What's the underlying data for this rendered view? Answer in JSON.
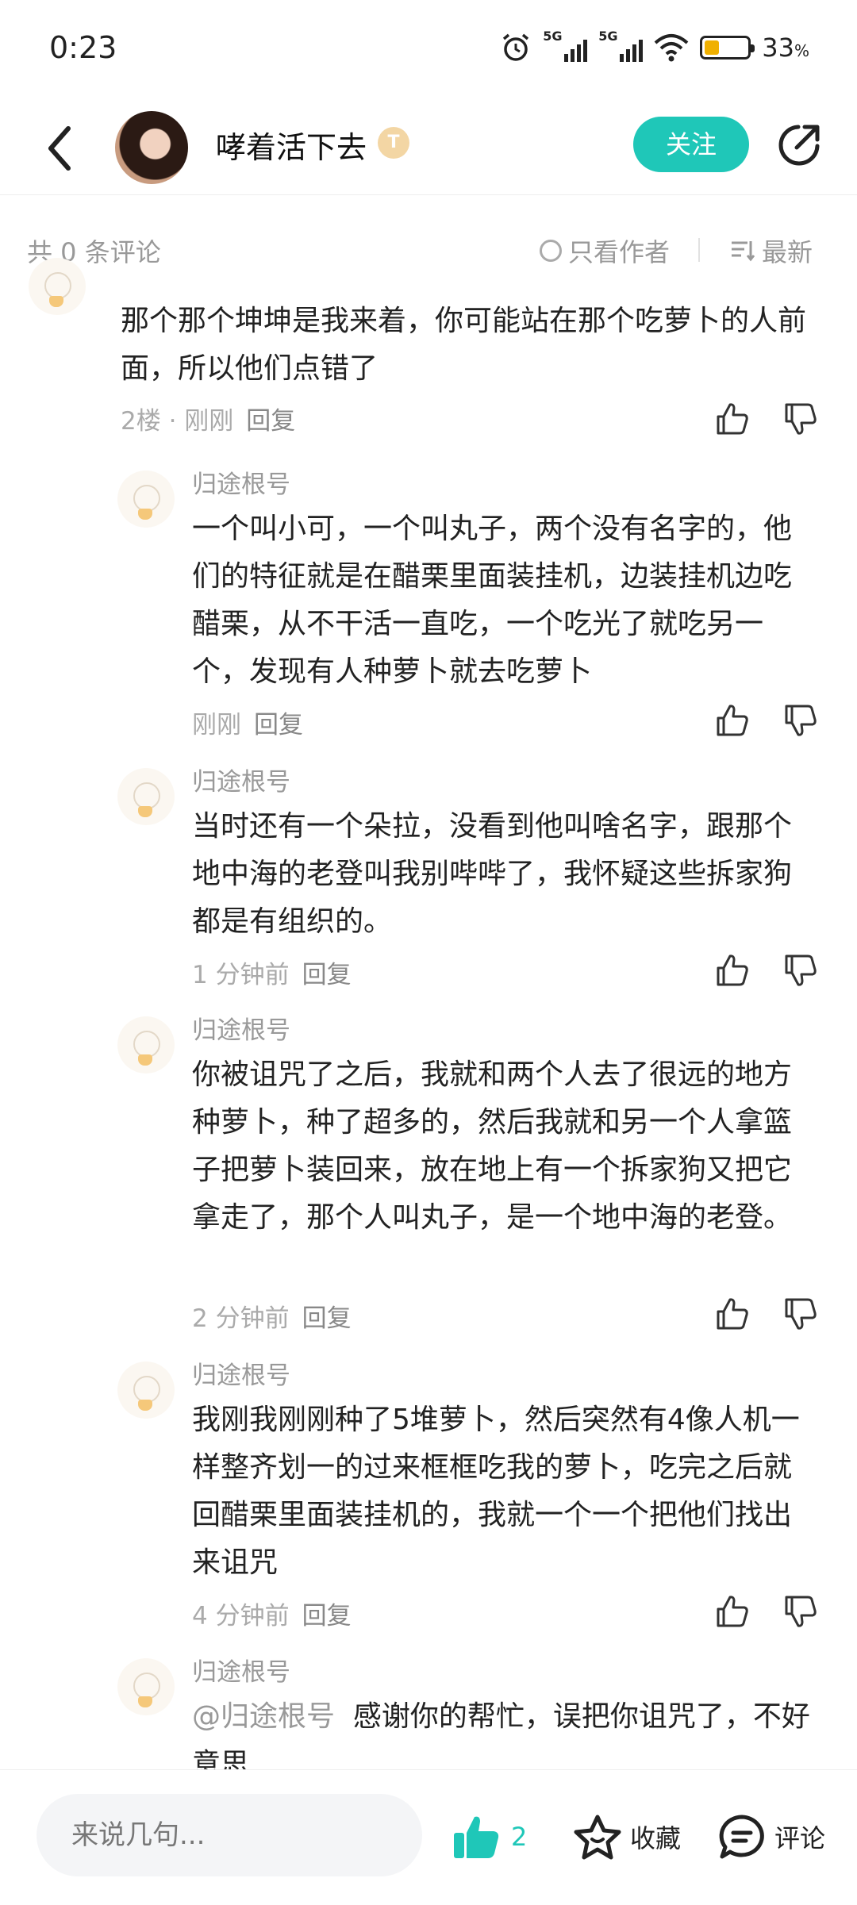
{
  "status": {
    "time": "0:23",
    "net1": "5G",
    "net2": "5G",
    "battery": "33",
    "battery_unit": "%"
  },
  "header": {
    "username": "哮着活下去",
    "badge": "T",
    "follow_label": "关注"
  },
  "toolbar": {
    "count_text": "共 0 条评论",
    "only_author": "只看作者",
    "sort": "最新"
  },
  "parent_comment": {
    "text": "那个那个坤坤是我来着，你可能站在那个吃萝卜的人前面，所以他们点错了",
    "floor": "2楼 · 刚刚",
    "reply": "回复"
  },
  "replies": [
    {
      "author": "归途根号",
      "text": "一个叫小可，一个叫丸子，两个没有名字的，他们的特征就是在醋栗里面装挂机，边装挂机边吃醋栗，从不干活一直吃，一个吃光了就吃另一个，发现有人种萝卜就去吃萝卜",
      "time": "刚刚",
      "reply": "回复"
    },
    {
      "author": "归途根号",
      "text": "当时还有一个朵拉，没看到他叫啥名字，跟那个地中海的老登叫我别哔哔了，我怀疑这些拆家狗都是有组织的。",
      "time": "1 分钟前",
      "reply": "回复"
    },
    {
      "author": "归途根号",
      "text": "你被诅咒了之后，我就和两个人去了很远的地方种萝卜，种了超多的，然后我就和另一个人拿篮子把萝卜装回来，放在地上有一个拆家狗又把它拿走了，那个人叫丸子，是一个地中海的老登。",
      "time": "2 分钟前",
      "reply": "回复"
    },
    {
      "author": "归途根号",
      "text": "我刚我刚刚种了5堆萝卜，然后突然有4像人机一样整齐划一的过来框框吃我的萝卜，吃完之后就回醋栗里面装挂机的，我就一个一个把他们找出来诅咒",
      "time": "4 分钟前",
      "reply": "回复"
    },
    {
      "author": "归途根号",
      "mention": "@归途根号",
      "text": "感谢你的帮忙，误把你诅咒了，不好意思"
    }
  ],
  "bottom": {
    "placeholder": "来说几句...",
    "like_count": "2",
    "favorite": "收藏",
    "comment": "评论"
  },
  "colors": {
    "accent": "#1fc7b8",
    "battery": "#f0b000"
  }
}
